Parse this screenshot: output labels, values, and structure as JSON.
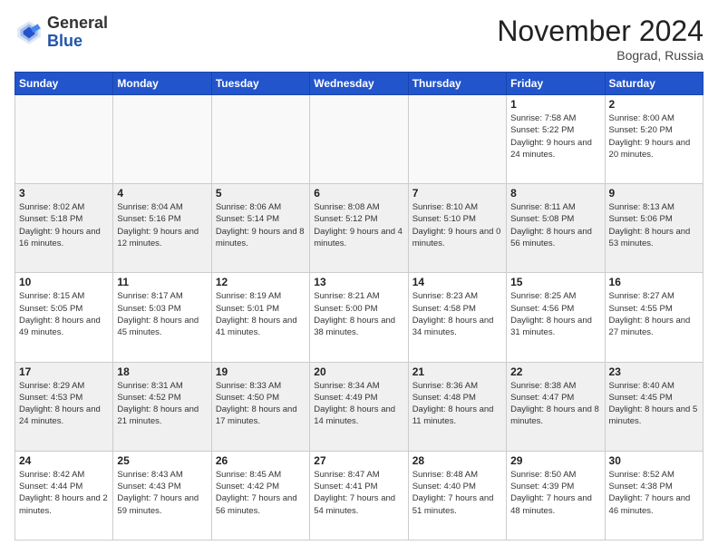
{
  "header": {
    "logo_line1": "General",
    "logo_line2": "Blue",
    "month_title": "November 2024",
    "location": "Bograd, Russia"
  },
  "weekdays": [
    "Sunday",
    "Monday",
    "Tuesday",
    "Wednesday",
    "Thursday",
    "Friday",
    "Saturday"
  ],
  "weeks": [
    [
      {
        "day": "",
        "info": ""
      },
      {
        "day": "",
        "info": ""
      },
      {
        "day": "",
        "info": ""
      },
      {
        "day": "",
        "info": ""
      },
      {
        "day": "",
        "info": ""
      },
      {
        "day": "1",
        "info": "Sunrise: 7:58 AM\nSunset: 5:22 PM\nDaylight: 9 hours\nand 24 minutes."
      },
      {
        "day": "2",
        "info": "Sunrise: 8:00 AM\nSunset: 5:20 PM\nDaylight: 9 hours\nand 20 minutes."
      }
    ],
    [
      {
        "day": "3",
        "info": "Sunrise: 8:02 AM\nSunset: 5:18 PM\nDaylight: 9 hours\nand 16 minutes."
      },
      {
        "day": "4",
        "info": "Sunrise: 8:04 AM\nSunset: 5:16 PM\nDaylight: 9 hours\nand 12 minutes."
      },
      {
        "day": "5",
        "info": "Sunrise: 8:06 AM\nSunset: 5:14 PM\nDaylight: 9 hours\nand 8 minutes."
      },
      {
        "day": "6",
        "info": "Sunrise: 8:08 AM\nSunset: 5:12 PM\nDaylight: 9 hours\nand 4 minutes."
      },
      {
        "day": "7",
        "info": "Sunrise: 8:10 AM\nSunset: 5:10 PM\nDaylight: 9 hours\nand 0 minutes."
      },
      {
        "day": "8",
        "info": "Sunrise: 8:11 AM\nSunset: 5:08 PM\nDaylight: 8 hours\nand 56 minutes."
      },
      {
        "day": "9",
        "info": "Sunrise: 8:13 AM\nSunset: 5:06 PM\nDaylight: 8 hours\nand 53 minutes."
      }
    ],
    [
      {
        "day": "10",
        "info": "Sunrise: 8:15 AM\nSunset: 5:05 PM\nDaylight: 8 hours\nand 49 minutes."
      },
      {
        "day": "11",
        "info": "Sunrise: 8:17 AM\nSunset: 5:03 PM\nDaylight: 8 hours\nand 45 minutes."
      },
      {
        "day": "12",
        "info": "Sunrise: 8:19 AM\nSunset: 5:01 PM\nDaylight: 8 hours\nand 41 minutes."
      },
      {
        "day": "13",
        "info": "Sunrise: 8:21 AM\nSunset: 5:00 PM\nDaylight: 8 hours\nand 38 minutes."
      },
      {
        "day": "14",
        "info": "Sunrise: 8:23 AM\nSunset: 4:58 PM\nDaylight: 8 hours\nand 34 minutes."
      },
      {
        "day": "15",
        "info": "Sunrise: 8:25 AM\nSunset: 4:56 PM\nDaylight: 8 hours\nand 31 minutes."
      },
      {
        "day": "16",
        "info": "Sunrise: 8:27 AM\nSunset: 4:55 PM\nDaylight: 8 hours\nand 27 minutes."
      }
    ],
    [
      {
        "day": "17",
        "info": "Sunrise: 8:29 AM\nSunset: 4:53 PM\nDaylight: 8 hours\nand 24 minutes."
      },
      {
        "day": "18",
        "info": "Sunrise: 8:31 AM\nSunset: 4:52 PM\nDaylight: 8 hours\nand 21 minutes."
      },
      {
        "day": "19",
        "info": "Sunrise: 8:33 AM\nSunset: 4:50 PM\nDaylight: 8 hours\nand 17 minutes."
      },
      {
        "day": "20",
        "info": "Sunrise: 8:34 AM\nSunset: 4:49 PM\nDaylight: 8 hours\nand 14 minutes."
      },
      {
        "day": "21",
        "info": "Sunrise: 8:36 AM\nSunset: 4:48 PM\nDaylight: 8 hours\nand 11 minutes."
      },
      {
        "day": "22",
        "info": "Sunrise: 8:38 AM\nSunset: 4:47 PM\nDaylight: 8 hours\nand 8 minutes."
      },
      {
        "day": "23",
        "info": "Sunrise: 8:40 AM\nSunset: 4:45 PM\nDaylight: 8 hours\nand 5 minutes."
      }
    ],
    [
      {
        "day": "24",
        "info": "Sunrise: 8:42 AM\nSunset: 4:44 PM\nDaylight: 8 hours\nand 2 minutes."
      },
      {
        "day": "25",
        "info": "Sunrise: 8:43 AM\nSunset: 4:43 PM\nDaylight: 7 hours\nand 59 minutes."
      },
      {
        "day": "26",
        "info": "Sunrise: 8:45 AM\nSunset: 4:42 PM\nDaylight: 7 hours\nand 56 minutes."
      },
      {
        "day": "27",
        "info": "Sunrise: 8:47 AM\nSunset: 4:41 PM\nDaylight: 7 hours\nand 54 minutes."
      },
      {
        "day": "28",
        "info": "Sunrise: 8:48 AM\nSunset: 4:40 PM\nDaylight: 7 hours\nand 51 minutes."
      },
      {
        "day": "29",
        "info": "Sunrise: 8:50 AM\nSunset: 4:39 PM\nDaylight: 7 hours\nand 48 minutes."
      },
      {
        "day": "30",
        "info": "Sunrise: 8:52 AM\nSunset: 4:38 PM\nDaylight: 7 hours\nand 46 minutes."
      }
    ]
  ]
}
